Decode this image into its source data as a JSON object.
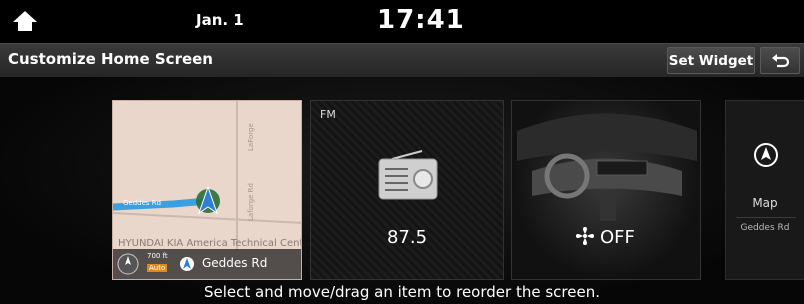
{
  "status": {
    "date": "Jan. 1",
    "time": "17:41"
  },
  "header": {
    "title": "Customize Home Screen",
    "set_widget_label": "Set Widget"
  },
  "cards": {
    "map": {
      "road_label": "Geddes Rd",
      "place_label": "HYUNDAI KIA America Technical Center",
      "scale_label": "700 ft",
      "scale_mode": "Auto",
      "street_1": "Geddes Rd",
      "street_2": "LaForge Rd"
    },
    "radio": {
      "band": "FM",
      "frequency": "87.5"
    },
    "climate": {
      "state": "OFF"
    },
    "widget": {
      "label": "Map",
      "sublabel": "Geddes Rd"
    }
  },
  "hint": "Select and move/drag an item to reorder the screen.",
  "colors": {
    "map_bg": "#ead7cc",
    "route": "#3aa0e0",
    "nav_arrow": "#2f7fd8"
  }
}
